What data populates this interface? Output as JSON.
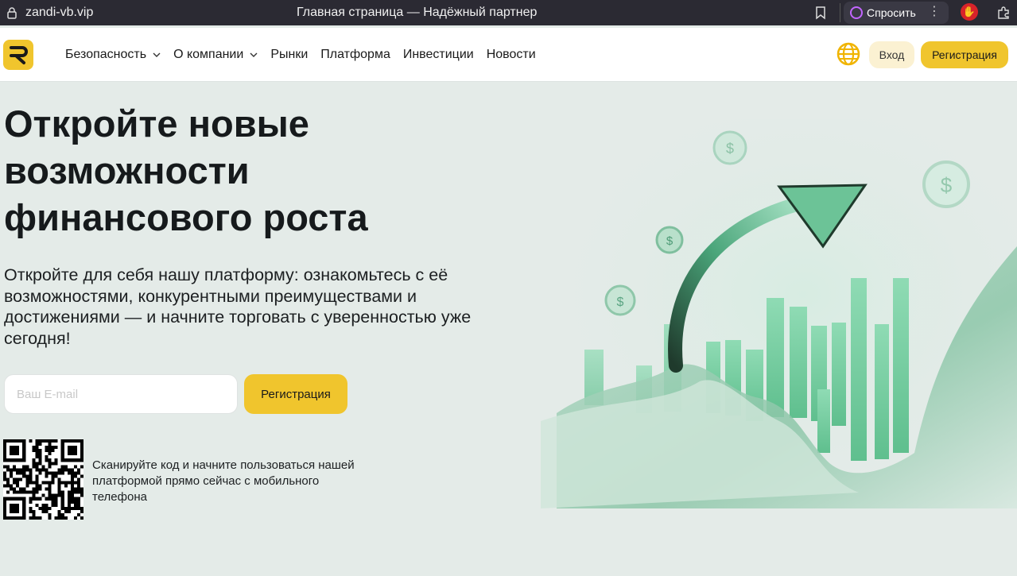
{
  "browser": {
    "url": "zandi-vb.vip",
    "tab_title": "Главная страница — Надёжный партнер",
    "ask_label": "Спросить"
  },
  "header": {
    "nav": [
      {
        "label": "Безопасность",
        "has_dropdown": true
      },
      {
        "label": "О компании",
        "has_dropdown": true
      },
      {
        "label": "Рынки",
        "has_dropdown": false
      },
      {
        "label": "Платформа",
        "has_dropdown": false
      },
      {
        "label": "Инвестиции",
        "has_dropdown": false
      },
      {
        "label": "Новости",
        "has_dropdown": false
      }
    ],
    "login_label": "Вход",
    "signup_label": "Регистрация"
  },
  "hero": {
    "title_line1": "Откройте новые",
    "title_line2": "возможности",
    "title_line3": "финансового роста",
    "subtitle": "Откройте для себя нашу платформу: ознакомьтесь с её возможностями, конкурентными преимуществами и достижениями — и начните торговать с уверенностью уже сегодня!",
    "email_placeholder": "Ваш E-mail",
    "signup_label": "Регистрация",
    "qr_text": "Сканируйте код и начните пользоваться нашей платформой прямо сейчас с мобильного телефона"
  },
  "colors": {
    "accent": "#f0c52d",
    "accent_soft": "#fbf1d2",
    "background": "#e4ebe8",
    "chart_green": "#5fbf8e"
  }
}
